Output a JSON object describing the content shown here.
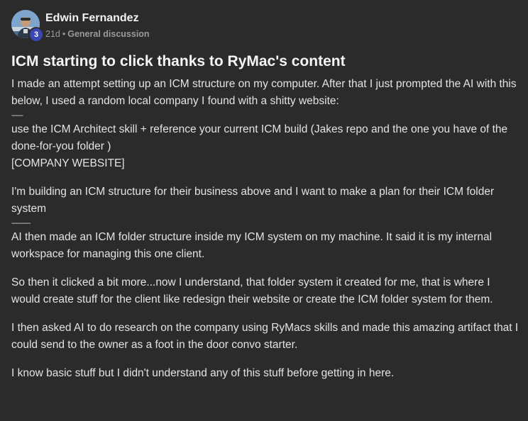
{
  "post": {
    "author": "Edwin Fernandez",
    "level": "3",
    "age": "21d",
    "separator": "•",
    "category": "General discussion",
    "title": "ICM starting to click thanks to RyMac's content",
    "paragraphs": {
      "p1_line1": "I made an attempt setting up an ICM structure on my computer. After that I just prompted the AI with this below, I used a random local company I found with a shitty website:",
      "divider1": "------",
      "p1_line2": "use the ICM Architect skill + reference your current ICM build (Jakes repo and the one you have of the done-for-you folder )",
      "p1_line3": "[COMPANY WEBSITE]",
      "p2_line1": "I'm building an ICM structure for their business above and I want to make a plan for their ICM folder system",
      "divider2": "----------",
      "p2_line2": "AI then made an ICM folder structure inside my ICM system on my machine. It said it is my internal workspace for managing this one client.",
      "p3": "So then it clicked a bit more...now I understand, that folder system it created for me, that is where I would create stuff for the client like redesign their website or create the ICM folder system for them.",
      "p4": "I then asked AI to do research on the company using RyMacs skills and made this amazing artifact that I could send to the owner as a foot in the door convo starter.",
      "p5": "I know basic stuff but I didn't understand any of this stuff before getting in here."
    }
  },
  "colors": {
    "background": "#2b2b2b",
    "text": "#e3e3e3",
    "muted": "#9a9a9a",
    "badge": "#3a47b3"
  },
  "icons": {
    "avatar": "user-photo-avatar"
  }
}
